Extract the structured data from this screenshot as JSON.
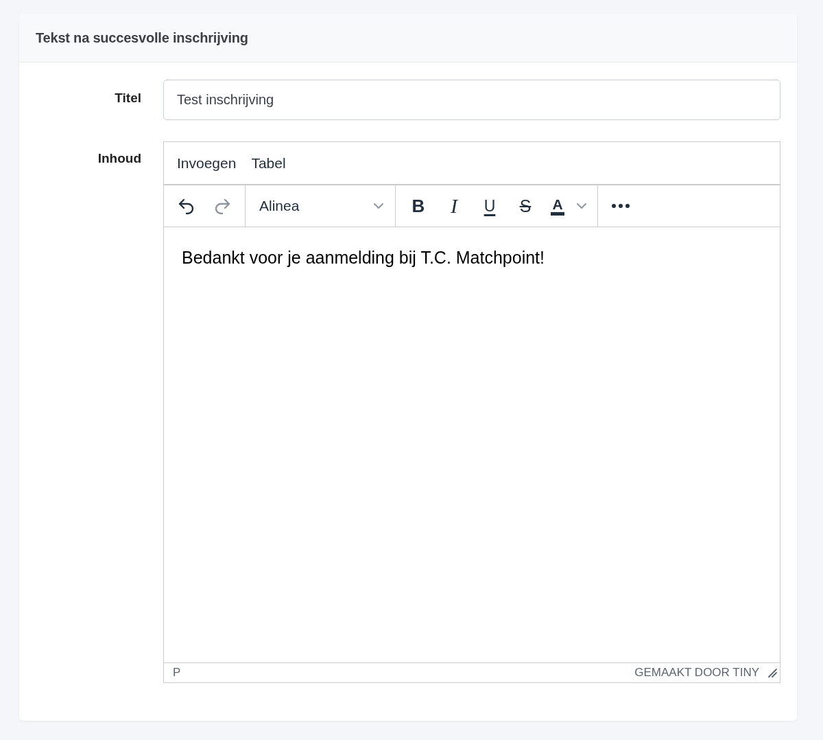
{
  "card": {
    "title": "Tekst na succesvolle inschrijving"
  },
  "fields": [
    {
      "kind": "input",
      "label": "Titel",
      "value": "Test inschrijving"
    },
    {
      "kind": "editor",
      "label": "Inhoud"
    }
  ],
  "editor": {
    "menu": [
      "Invoegen",
      "Tabel"
    ],
    "history": [
      {
        "kind": "undo",
        "disabled": false
      },
      {
        "kind": "redo",
        "disabled": true
      }
    ],
    "block_format": "Alinea",
    "formats": [
      {
        "kind": "bold",
        "label": "B"
      },
      {
        "kind": "italic",
        "label": "I"
      },
      {
        "kind": "underline",
        "label": "U"
      },
      {
        "kind": "strike",
        "label": "S"
      },
      {
        "kind": "color",
        "label": "A"
      }
    ],
    "content": "Bedankt voor je aanmelding bij T.C. Matchpoint!",
    "path": "P",
    "branding": "GEMAAKT DOOR TINY"
  }
}
